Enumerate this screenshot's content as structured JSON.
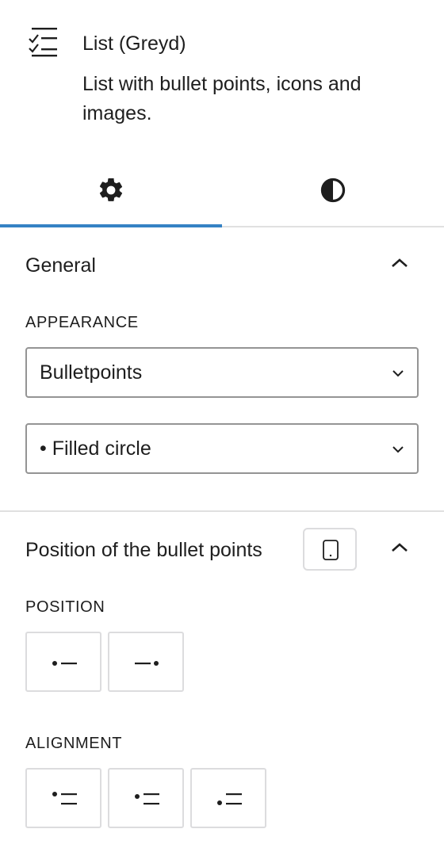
{
  "block": {
    "title": "List (Greyd)",
    "description": "List with bullet points, icons and images.",
    "icon": "list-check-icon"
  },
  "tabs": [
    {
      "name": "settings",
      "icon": "gear-icon",
      "active": true
    },
    {
      "name": "styles",
      "icon": "contrast-icon",
      "active": false
    }
  ],
  "general": {
    "title": "General",
    "appearance_label": "APPEARANCE",
    "appearance_value": "Bulletpoints",
    "bullet_value": "• Filled circle"
  },
  "position_panel": {
    "title": "Position of the bullet points",
    "device_icon": "mobile-device-icon",
    "position_label": "POSITION",
    "position_options": [
      "bullet-left-icon",
      "bullet-right-icon"
    ],
    "alignment_label": "ALIGNMENT",
    "alignment_options": [
      "align-top-icon",
      "align-middle-icon",
      "align-bottom-icon"
    ]
  },
  "colors": {
    "accent": "#3582c4",
    "border": "#949494",
    "divider": "#e0e0e0",
    "text": "#1e1e1e"
  }
}
